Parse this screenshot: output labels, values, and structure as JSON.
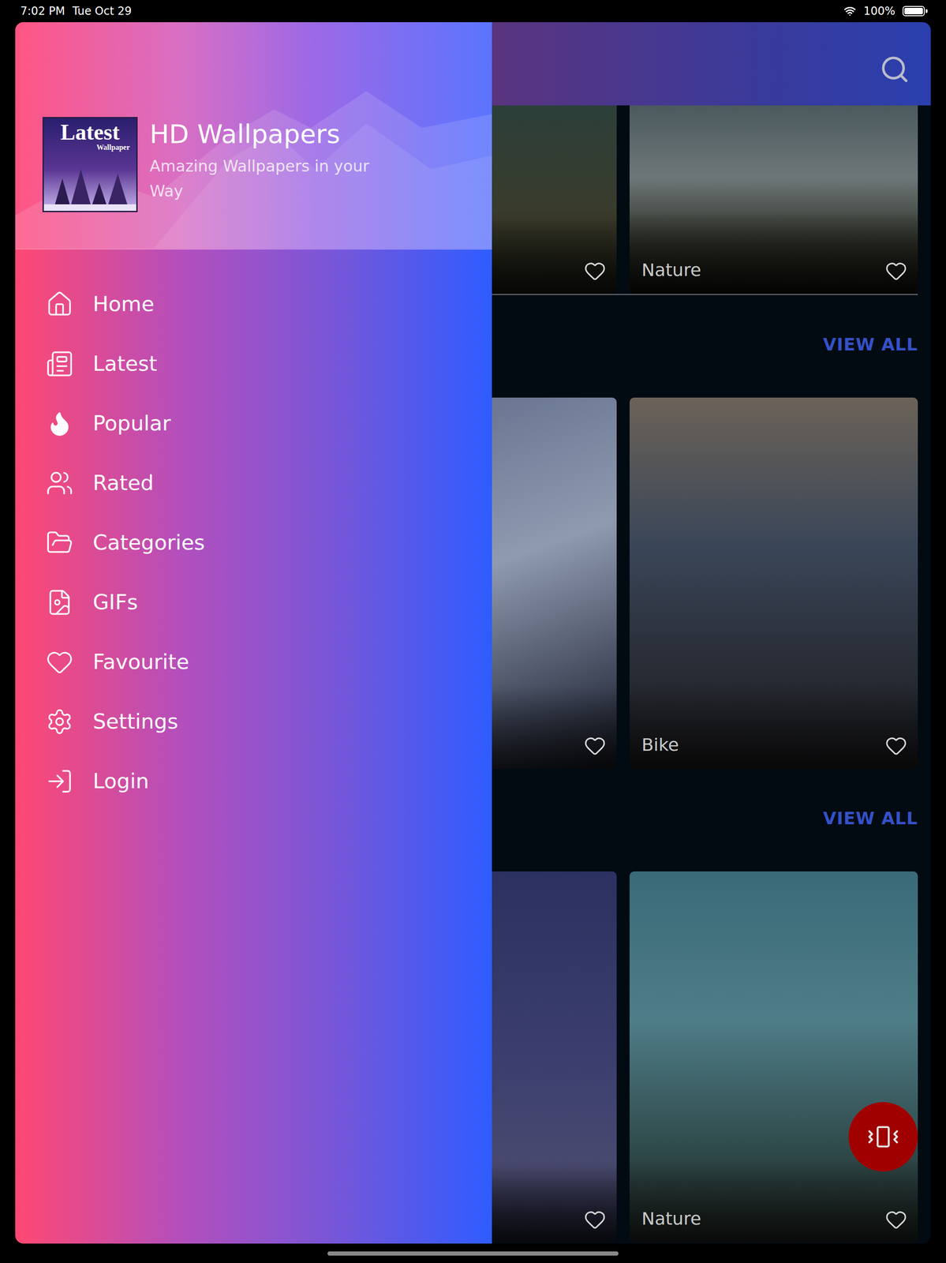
{
  "status_bar": {
    "time": "7:02 PM",
    "date": "Tue Oct 29",
    "battery": "100%",
    "battery_level": 1.0
  },
  "drawer": {
    "logo": {
      "title": "Latest",
      "subtitle": "Wallpaper"
    },
    "title": "HD Wallpapers",
    "tagline": "Amazing Wallpapers in your Way",
    "items": [
      {
        "label": "Home"
      },
      {
        "label": "Latest"
      },
      {
        "label": "Popular"
      },
      {
        "label": "Rated"
      },
      {
        "label": "Categories"
      },
      {
        "label": "GIFs"
      },
      {
        "label": "Favourite"
      },
      {
        "label": "Settings"
      },
      {
        "label": "Login"
      }
    ]
  },
  "feed": {
    "sections": [
      {
        "divider": true,
        "cards": [
          {
            "favourite": false
          },
          {
            "label": "Nature",
            "favourite": false
          }
        ]
      },
      {
        "divider": false,
        "action": "VIEW ALL",
        "cards": [
          {
            "favourite": false
          },
          {
            "label": "Bike",
            "favourite": false
          }
        ]
      },
      {
        "divider": false,
        "action": "VIEW ALL",
        "cards": [
          {
            "favourite": false
          },
          {
            "label": "Nature",
            "favourite": false
          }
        ]
      }
    ]
  }
}
